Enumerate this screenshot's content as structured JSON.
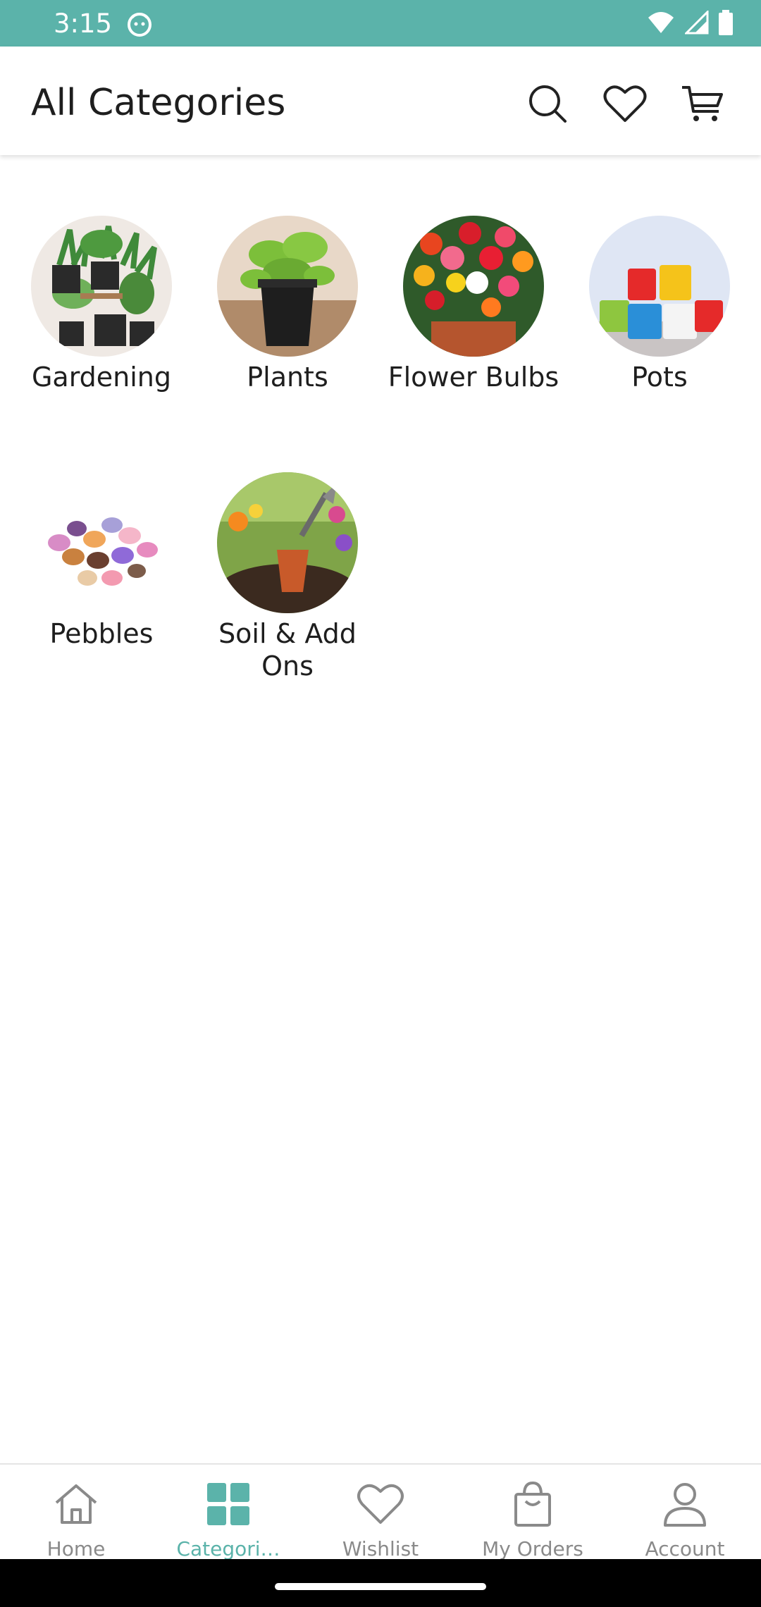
{
  "status_bar": {
    "time": "3:15"
  },
  "app_bar": {
    "title": "All Categories",
    "actions": [
      "search-icon",
      "heart-icon",
      "cart-icon"
    ]
  },
  "categories": [
    {
      "label": "Gardening",
      "icon": "gardening-image"
    },
    {
      "label": "Plants",
      "icon": "plants-image"
    },
    {
      "label": "Flower Bulbs",
      "icon": "flower-bulbs-image"
    },
    {
      "label": "Pots",
      "icon": "pots-image"
    },
    {
      "label": "Pebbles",
      "icon": "pebbles-image"
    },
    {
      "label": "Soil & Add Ons",
      "icon": "soil-image"
    }
  ],
  "bottom_nav": {
    "items": [
      {
        "label": "Home",
        "icon": "home-icon"
      },
      {
        "label": "Categori…",
        "icon": "grid-icon",
        "active": true
      },
      {
        "label": "Wishlist",
        "icon": "heart-icon"
      },
      {
        "label": "My Orders",
        "icon": "bag-icon"
      },
      {
        "label": "Account",
        "icon": "person-icon"
      }
    ]
  },
  "colors": {
    "accent": "#5bb3aa",
    "text": "#1e1e1e",
    "muted": "#8a8a8a"
  }
}
